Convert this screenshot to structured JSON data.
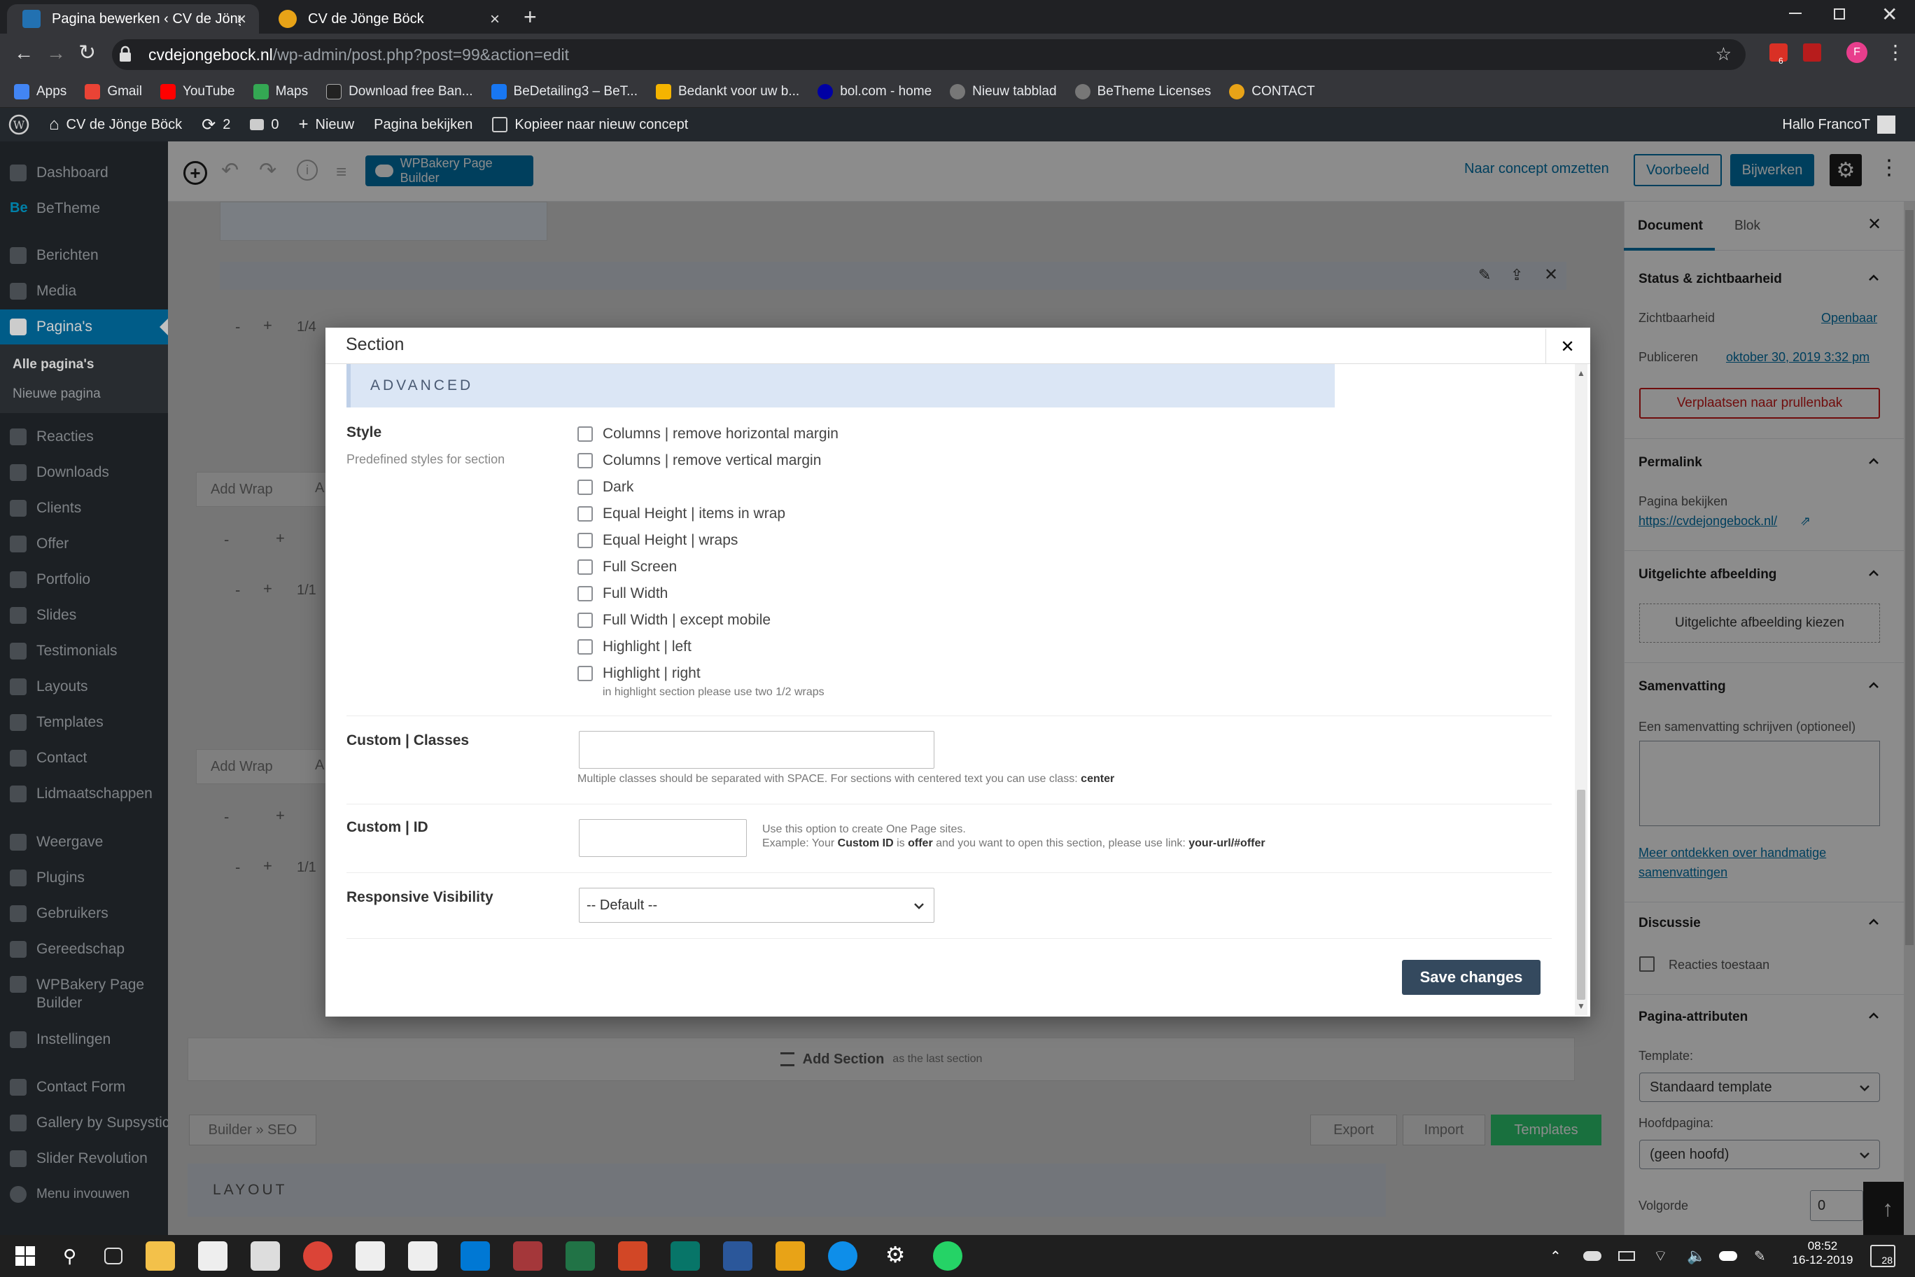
{
  "browser": {
    "tabs": [
      {
        "title": "Pagina bewerken ‹ CV de Jönge B",
        "close": "×"
      },
      {
        "title": "CV de Jönge Böck",
        "close": "×"
      }
    ],
    "new_tab": "+",
    "url_host": "cvdejongebock.nl",
    "url_path": "/wp-admin/post.php?post=99&action=edit",
    "ext_badge": "6",
    "profile_initial": "F",
    "bookmarks": [
      {
        "label": "Apps",
        "color": "#4285f4"
      },
      {
        "label": "Gmail",
        "color": "#ea4335"
      },
      {
        "label": "YouTube",
        "color": "#ff0000"
      },
      {
        "label": "Maps",
        "color": "#34a853"
      },
      {
        "label": "Download free Ban...",
        "color": "#222222"
      },
      {
        "label": "BeDetailing3 – BeT...",
        "color": "#1877f2"
      },
      {
        "label": "Bedankt voor uw b...",
        "color": "#f4b400"
      },
      {
        "label": "bol.com - home",
        "color": "#0000a4"
      },
      {
        "label": "Nieuw tabblad",
        "color": "#777777"
      },
      {
        "label": "BeTheme Licenses",
        "color": "#777777"
      },
      {
        "label": "CONTACT",
        "color": "#e8a317"
      }
    ]
  },
  "adminbar": {
    "site": "CV de Jönge Böck",
    "updates": "2",
    "comments": "0",
    "new": "Nieuw",
    "view": "Pagina bekijken",
    "copy": "Kopieer naar nieuw concept",
    "greeting": "Hallo FrancoT"
  },
  "sidebar": {
    "items": [
      {
        "label": "Dashboard"
      },
      {
        "label": "BeTheme"
      },
      {
        "label": "Berichten"
      },
      {
        "label": "Media"
      },
      {
        "label": "Pagina's"
      },
      {
        "label": "Reacties"
      },
      {
        "label": "Downloads"
      },
      {
        "label": "Clients"
      },
      {
        "label": "Offer"
      },
      {
        "label": "Portfolio"
      },
      {
        "label": "Slides"
      },
      {
        "label": "Testimonials"
      },
      {
        "label": "Layouts"
      },
      {
        "label": "Templates"
      },
      {
        "label": "Contact"
      },
      {
        "label": "Lidmaatschappen"
      },
      {
        "label": "Weergave"
      },
      {
        "label": "Plugins"
      },
      {
        "label": "Gebruikers"
      },
      {
        "label": "Gereedschap"
      },
      {
        "label": "WPBakery Page Builder"
      },
      {
        "label": "Instellingen"
      },
      {
        "label": "Contact Form"
      },
      {
        "label": "Gallery by Supsystic"
      },
      {
        "label": "Slider Revolution"
      },
      {
        "label": "Menu invouwen"
      }
    ],
    "sub_all": "Alle pagina's",
    "sub_new": "Nieuwe pagina",
    "betheme_badge": "Be"
  },
  "toolbar": {
    "wpbakery": "WPBakery Page Builder",
    "draft": "Naar concept omzetten",
    "preview": "Voorbeeld",
    "update": "Bijwerken"
  },
  "editor_bg": {
    "add_wrap": "Add Wrap",
    "add_wrap_clip": "A",
    "minus": "-",
    "plus": "+",
    "size_quarter": "1/4",
    "size_full": "1/1",
    "add_section": "Add Section",
    "add_section_hint": "as the last section",
    "builder_seo": "Builder » SEO",
    "export": "Export",
    "import": "Import",
    "templates": "Templates",
    "layout": "LAYOUT"
  },
  "rpanel": {
    "tab_document": "Document",
    "tab_block": "Blok",
    "status_title": "Status & zichtbaarheid",
    "visibility_label": "Zichtbaarheid",
    "visibility_value": "Openbaar",
    "publish_label": "Publiceren",
    "publish_value": "oktober 30, 2019 3:32 pm",
    "trash": "Verplaatsen naar prullenbak",
    "permalink_title": "Permalink",
    "permalink_label": "Pagina bekijken",
    "permalink_url": "https://cvdejongebock.nl/",
    "featured_title": "Uitgelichte afbeelding",
    "featured_btn": "Uitgelichte afbeelding kiezen",
    "excerpt_title": "Samenvatting",
    "excerpt_label": "Een samenvatting schrijven (optioneel)",
    "excerpt_link": "Meer ontdekken over handmatige samenvattingen",
    "discussion_title": "Discussie",
    "comments_allow": "Reacties toestaan",
    "attributes_title": "Pagina-attributen",
    "template_label": "Template:",
    "template_value": "Standaard template",
    "parent_label": "Hoofdpagina:",
    "parent_value": "(geen hoofd)",
    "order_label": "Volgorde",
    "order_value": "0"
  },
  "modal": {
    "title": "Section",
    "close": "✕",
    "advanced": "ADVANCED",
    "style_label": "Style",
    "style_desc": "Predefined styles for section",
    "style_options": [
      "Columns | remove horizontal margin",
      "Columns | remove vertical margin",
      "Dark",
      "Equal Height | items in wrap",
      "Equal Height | wraps",
      "Full Screen",
      "Full Width",
      "Full Width | except mobile",
      "Highlight | left",
      "Highlight | right"
    ],
    "style_hint": "in highlight section please use two 1/2 wraps",
    "classes_label": "Custom | Classes",
    "classes_value": "",
    "classes_hint": "Multiple classes should be separated with SPACE. For sections with centered text you can use class:",
    "classes_hint_code": "center",
    "id_label": "Custom | ID",
    "id_value": "",
    "id_hint_1": "Use this option to create One Page sites.",
    "id_hint_2a": "Example: Your",
    "id_hint_2b": "Custom ID",
    "id_hint_2c": "is",
    "id_hint_2d": "offer",
    "id_hint_2e": "and you want to open this section, please use link:",
    "id_hint_2f": "your-url/#offer",
    "visibility_label": "Responsive Visibility",
    "visibility_value": "-- Default --",
    "save": "Save changes"
  },
  "taskbar": {
    "time": "08:52",
    "date": "16-12-2019",
    "notif": "28"
  },
  "colors": {
    "wp_blue": "#0073aa",
    "admin_dark": "#23282d",
    "save_btn": "#34495e",
    "templates_btn": "#2ecc71",
    "trash_red": "#cc1818"
  }
}
